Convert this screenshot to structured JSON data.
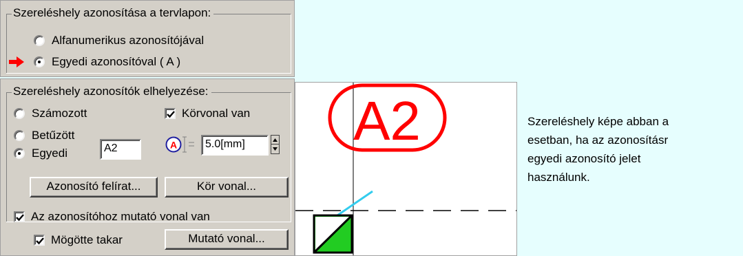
{
  "identification_group": {
    "title": "Szereléshely azonosítása a tervlapon:",
    "options": [
      {
        "label": "Alfanumerikus azonosítójával",
        "checked": false
      },
      {
        "label": "Egyedi azonosítóval ( A )",
        "checked": true
      }
    ],
    "pointer_icon": "red-arrow-icon"
  },
  "placement_group": {
    "title": "Szereléshely azonosítók elhelyezése:",
    "radios": [
      {
        "label": "Számozott",
        "checked": false
      },
      {
        "label": "Betűzött",
        "checked": false
      },
      {
        "label": "Egyedi",
        "checked": true
      }
    ],
    "unique_value": "A2",
    "outline_checkbox": {
      "label": "Körvonal van",
      "checked": true
    },
    "size_icon": "circle-a-height-icon",
    "size_value": "5.0[mm]",
    "buttons": {
      "label_button": "Azonosító felírat...",
      "circle_button": "Kör vonal...",
      "pointer_button": "Mutató vonal..."
    },
    "pointer_line_checkbox": {
      "label": "Az azonosítóhoz mutató vonal van",
      "checked": true
    },
    "hide_behind_checkbox": {
      "label": "Mögötte takar",
      "checked": true
    }
  },
  "preview": {
    "label": "A2",
    "label_color": "#ff0000",
    "leader_color": "#33ccee",
    "fill_color": "#22cc22"
  },
  "description": "Szereléshely képe abban a\nesetban, ha az azonosításr\negyedi azonosító jelet\nhasználunk."
}
